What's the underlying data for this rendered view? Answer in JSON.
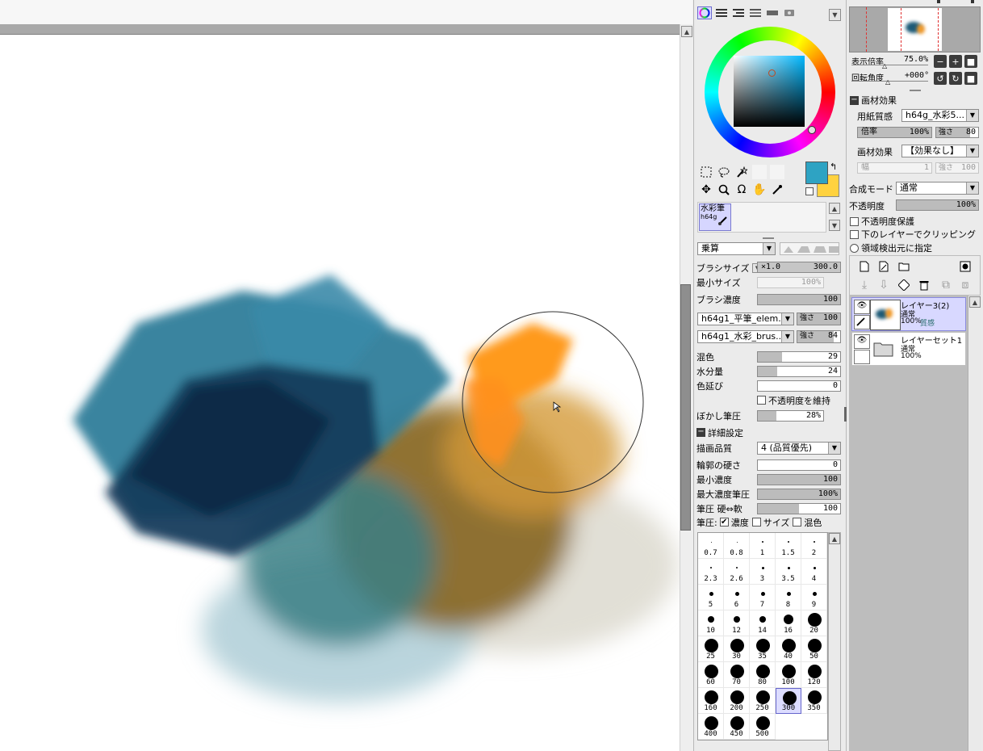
{
  "canvas": {
    "colors": {
      "teal": "#2f7d9a",
      "navy": "#10304a",
      "orange": "#ff9a1a",
      "olive": "#8a6a20",
      "grey": "#d8d6cc"
    }
  },
  "color_panel": {
    "mode_tabs": [
      "color-wheel",
      "rgb-sliders",
      "hsv-sliders",
      "color-swatches",
      "swatch-grid",
      "scratchpad"
    ],
    "foreground_color": "#2ea3c3",
    "background_color": "#ffd23f"
  },
  "tool_icons": [
    "selection-icon",
    "lasso-icon",
    "magic-wand-icon",
    "move-icon",
    "zoom-icon",
    "rotate-icon",
    "hand-icon",
    "eyedropper-icon"
  ],
  "brush_slot": {
    "name": "水彩筆",
    "preset": "h64g"
  },
  "brush": {
    "blend_mode": "乗算",
    "size_label": "ブラシサイズ",
    "size_multiplier": "×1.0",
    "size_value": "300.0",
    "min_size_label": "最小サイズ",
    "min_size_value": "100%",
    "density_label": "ブラシ濃度",
    "density_value": "100",
    "texture1": "h64g1_平筆_elem...",
    "texture1_strength_label": "強さ",
    "texture1_strength": "100",
    "texture2": "h64g1_水彩_brus...",
    "texture2_strength_label": "強さ",
    "texture2_strength": "84",
    "mix_label": "混色",
    "mix_value": "29",
    "water_label": "水分量",
    "water_value": "24",
    "stretch_label": "色延び",
    "stretch_value": "0",
    "keep_opacity_label": "不透明度を維持",
    "blur_label": "ぼかし筆圧",
    "blur_value": "28%",
    "advanced_label": "詳細設定",
    "quality_label": "描画品質",
    "quality_value": "4 (品質優先)",
    "edge_label": "輪郭の硬さ",
    "edge_value": "0",
    "min_density_label": "最小濃度",
    "min_density_value": "100",
    "max_density_pressure_label": "最大濃度筆圧",
    "max_density_pressure_value": "100%",
    "pressure_hardness_label": "筆圧 硬⇔軟",
    "pressure_hardness_value": "100",
    "pressure_label": "筆圧:",
    "pressure_density_label": "濃度",
    "pressure_size_label": "サイズ",
    "pressure_mix_label": "混色"
  },
  "brush_sizes": [
    "0.7",
    "0.8",
    "1",
    "1.5",
    "2",
    "2.3",
    "2.6",
    "3",
    "3.5",
    "4",
    "5",
    "6",
    "7",
    "8",
    "9",
    "10",
    "12",
    "14",
    "16",
    "20",
    "25",
    "30",
    "35",
    "40",
    "50",
    "60",
    "70",
    "80",
    "100",
    "120",
    "160",
    "200",
    "250",
    "300",
    "350",
    "400",
    "450",
    "500"
  ],
  "selected_brush_size": "300",
  "navigator": {
    "zoom_label": "表示倍率",
    "zoom_value": "75.0%",
    "rotate_label": "回転角度",
    "rotate_value": "+000°"
  },
  "paper_effects": {
    "section_label": "画材効果",
    "paper_texture_label": "用紙質感",
    "paper_texture_value": "h64g_水彩5...",
    "scale_label": "倍率",
    "scale_value": "100%",
    "strength_label": "強さ",
    "strength_value": "80",
    "effect_label": "画材効果",
    "effect_value": "【効果なし】",
    "width_label": "幅",
    "width_value": "1",
    "effect_strength_label": "強さ",
    "effect_strength_value": "100"
  },
  "layer_props": {
    "blend_label": "合成モード",
    "blend_value": "通常",
    "opacity_label": "不透明度",
    "opacity_value": "100%",
    "protect_opacity": "不透明度保護",
    "clipping": "下のレイヤーでクリッピング",
    "selection_source": "領域検出元に指定"
  },
  "layers": [
    {
      "name": "レイヤー3(2)",
      "mode": "通常",
      "opacity": "100%",
      "extra": "質感",
      "selected": true,
      "type": "layer"
    },
    {
      "name": "レイヤーセット1",
      "mode": "通常",
      "opacity": "100%",
      "extra": "",
      "selected": false,
      "type": "folder"
    }
  ]
}
